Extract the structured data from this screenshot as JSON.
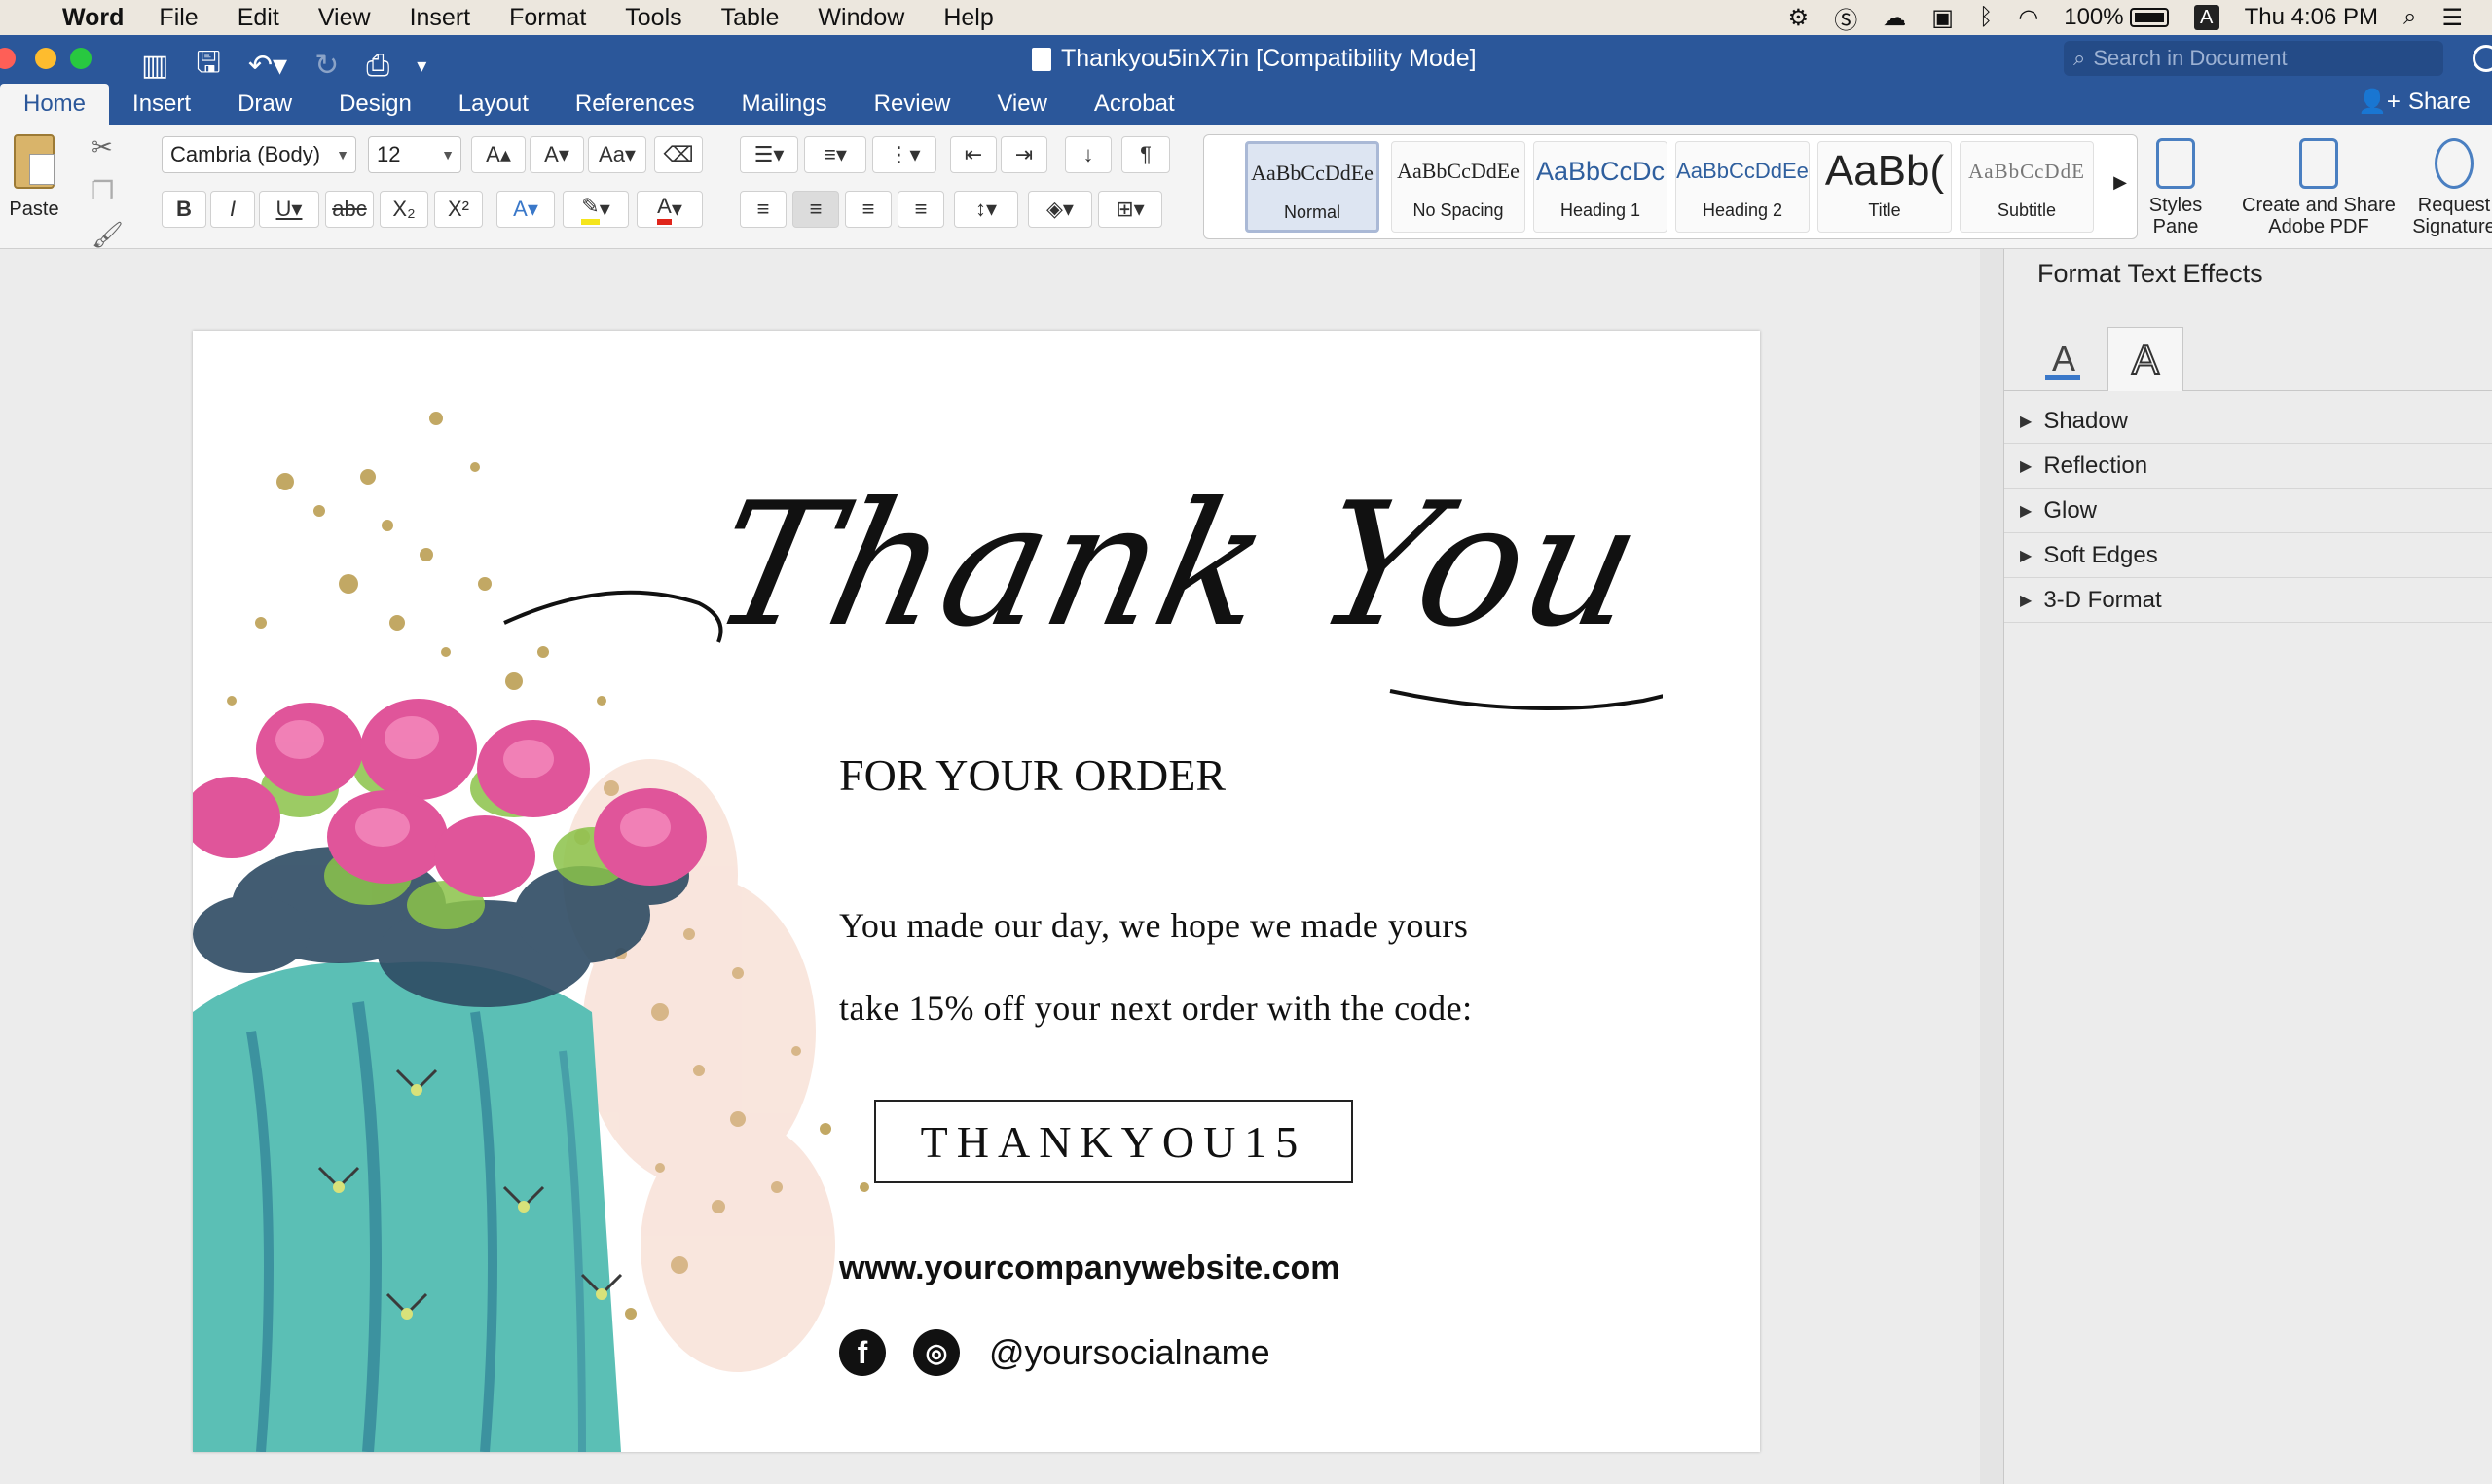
{
  "menubar": {
    "app_name": "Word",
    "menus": [
      "File",
      "Edit",
      "View",
      "Insert",
      "Format",
      "Tools",
      "Table",
      "Window",
      "Help"
    ],
    "battery": "100%",
    "input_badge": "A",
    "clock": "Thu 4:06 PM"
  },
  "titlebar": {
    "doc_title": "Thankyou5inX7in [Compatibility Mode]",
    "search_placeholder": "Search in Document"
  },
  "tabs": [
    "Home",
    "Insert",
    "Draw",
    "Design",
    "Layout",
    "References",
    "Mailings",
    "Review",
    "View",
    "Acrobat"
  ],
  "active_tab": "Home",
  "share_label": "Share",
  "ribbon": {
    "paste_label": "Paste",
    "font_name": "Cambria (Body)",
    "font_size": "12",
    "styles": [
      {
        "sample": "AaBbCcDdEe",
        "name": "Normal"
      },
      {
        "sample": "AaBbCcDdEe",
        "name": "No Spacing"
      },
      {
        "sample": "AaBbCcDc",
        "name": "Heading 1"
      },
      {
        "sample": "AaBbCcDdEe",
        "name": "Heading 2"
      },
      {
        "sample": "AaBb(",
        "name": "Title"
      },
      {
        "sample": "AaBbCcDdE",
        "name": "Subtitle"
      }
    ],
    "styles_pane_label": "Styles Pane",
    "create_pdf_label": "Create and Share Adobe PDF",
    "request_sig_label": "Request Signature"
  },
  "document": {
    "script_title": "Thank You",
    "subtitle": "FOR YOUR ORDER",
    "line1": "You made our day, we hope we made yours",
    "line2": "take 15% off your next order with the code:",
    "code": "THANKYOU15",
    "website": "www.yourcompanywebsite.com",
    "social_handle": "@yoursocialname"
  },
  "pane": {
    "title": "Format Text Effects",
    "sections": [
      "Shadow",
      "Reflection",
      "Glow",
      "Soft Edges",
      "3-D Format"
    ]
  },
  "colors": {
    "word_blue": "#2b579a",
    "cactus_teal": "#5bbfb5",
    "flower_pink": "#e0559a",
    "gold": "#b89a4a"
  }
}
